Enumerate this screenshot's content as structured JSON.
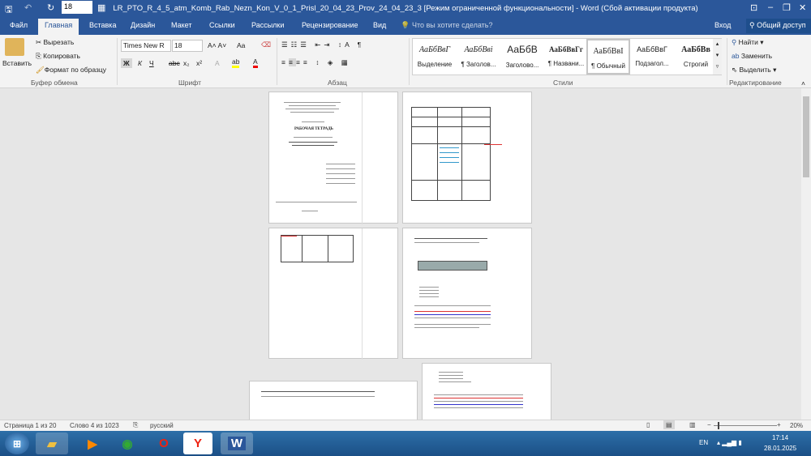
{
  "window": {
    "title": "LR_PTO_R_4_5_atm_Komb_Rab_Nezn_Kon_V_0_1_Prisl_20_04_23_Prov_24_04_23_3 [Режим ограниченной функциональности] - Word (Сбой активации продукта)",
    "font_size_quick": "18"
  },
  "tabs": [
    "Файл",
    "Главная",
    "Вставка",
    "Дизайн",
    "Макет",
    "Ссылки",
    "Рассылки",
    "Рецензирование",
    "Вид"
  ],
  "tell_me": "Что вы хотите сделать?",
  "signin": "Вход",
  "share": "Общий доступ",
  "clipboard": {
    "paste": "Вставить",
    "cut": "Вырезать",
    "copy": "Копировать",
    "format_painter": "Формат по образцу",
    "group": "Буфер обмена"
  },
  "font": {
    "name": "Times New R",
    "size": "18",
    "group": "Шрифт",
    "bold": "Ж",
    "italic": "К",
    "underline": "Ч",
    "strike": "abc",
    "sub": "x₂",
    "sup": "x²",
    "case": "Aa"
  },
  "paragraph": {
    "group": "Абзац"
  },
  "styles": {
    "group": "Стили",
    "items": [
      {
        "sample": "АаБбВвГ",
        "label": "Выделение"
      },
      {
        "sample": "АаБбВві",
        "label": "¶ Заголов..."
      },
      {
        "sample": "АаБбВ",
        "label": "Заголово..."
      },
      {
        "sample": "АаБбВвГг",
        "label": "¶ Названи..."
      },
      {
        "sample": "АаБбВвІ",
        "label": "¶ Обычный"
      },
      {
        "sample": "АаБбВвГ",
        "label": "Подзагол..."
      },
      {
        "sample": "АаБбВв",
        "label": "Строгий"
      }
    ]
  },
  "editing": {
    "find": "Найти",
    "replace": "Заменить",
    "select": "Выделить",
    "group": "Редактирование"
  },
  "document": {
    "page1_heading": "РАБОЧАЯ ТЕТРАДЬ"
  },
  "status": {
    "page": "Страница 1 из 20",
    "words": "Слово 4 из 1023",
    "language": "русский",
    "zoom": "20%",
    "zoom_percent": 20
  },
  "taskbar": {
    "lang": "EN",
    "time": "17:14",
    "date": "28.01.2025"
  }
}
